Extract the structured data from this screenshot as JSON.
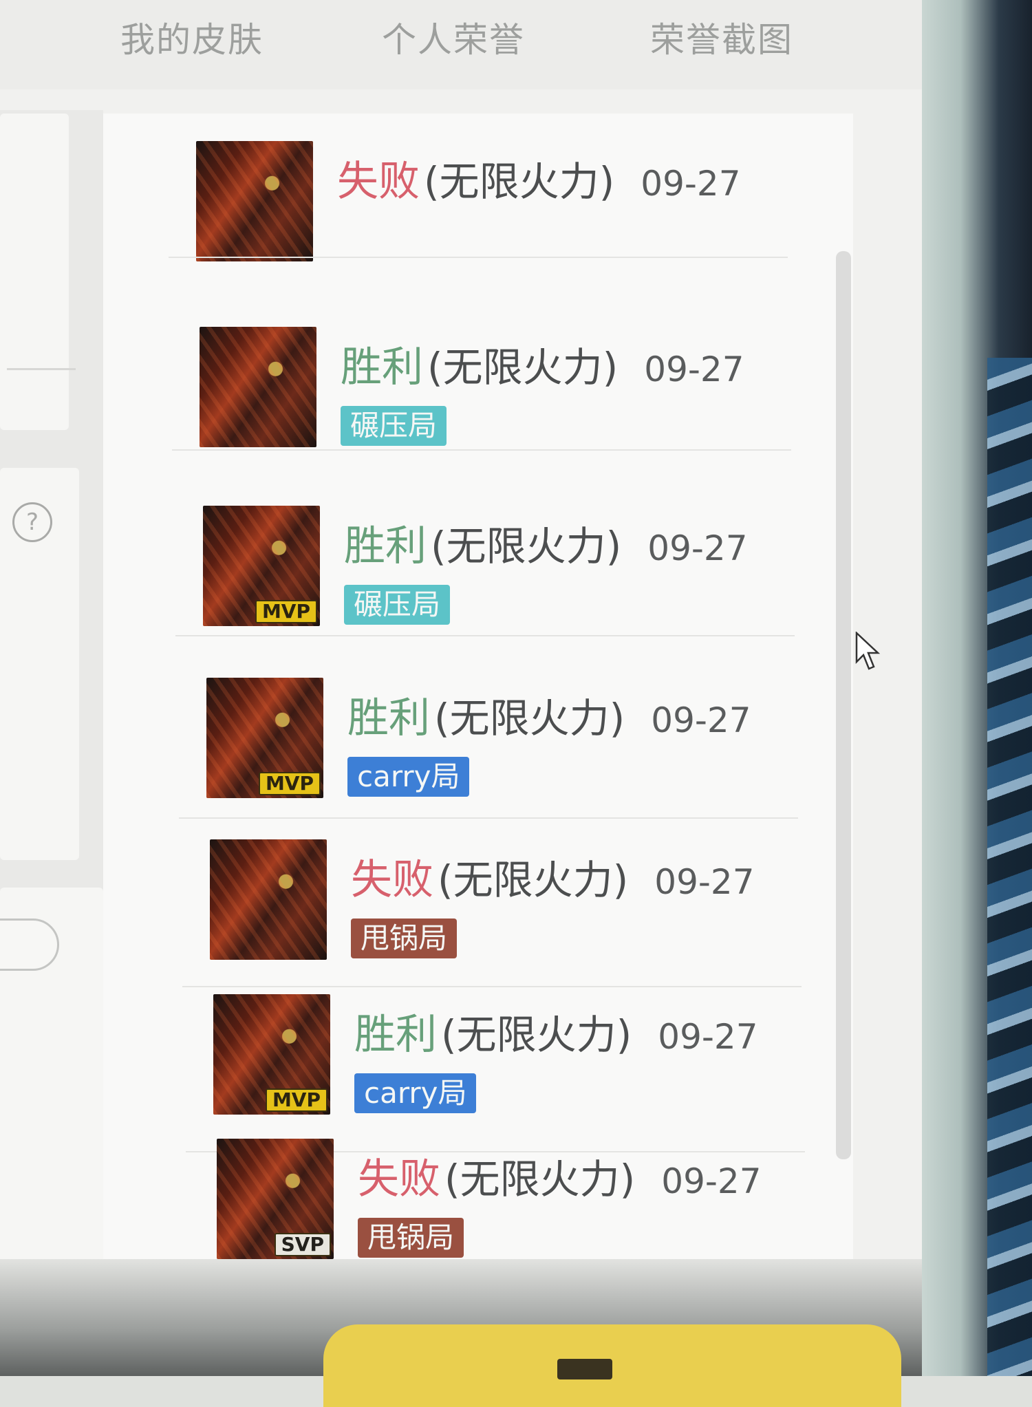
{
  "tabs": {
    "skins": "我的皮肤",
    "honor": "个人荣誉",
    "screenshots": "荣誉截图"
  },
  "sidebar": {
    "help_glyph": "?"
  },
  "matches": [
    {
      "result": "失败",
      "result_type": "lose",
      "mode": "(无限火力)",
      "date": "09-27",
      "badge": "",
      "tag": "",
      "tag_color": ""
    },
    {
      "result": "胜利",
      "result_type": "win",
      "mode": "(无限火力)",
      "date": "09-27",
      "badge": "",
      "tag": "碾压局",
      "tag_color": "#5cc3c8"
    },
    {
      "result": "胜利",
      "result_type": "win",
      "mode": "(无限火力)",
      "date": "09-27",
      "badge": "MVP",
      "tag": "碾压局",
      "tag_color": "#5cc3c8"
    },
    {
      "result": "胜利",
      "result_type": "win",
      "mode": "(无限火力)",
      "date": "09-27",
      "badge": "MVP",
      "tag": "carry局",
      "tag_color": "#3d7fd6"
    },
    {
      "result": "失败",
      "result_type": "lose",
      "mode": "(无限火力)",
      "date": "09-27",
      "badge": "",
      "tag": "甩锅局",
      "tag_color": "#9a5040"
    },
    {
      "result": "胜利",
      "result_type": "win",
      "mode": "(无限火力)",
      "date": "09-27",
      "badge": "MVP",
      "tag": "carry局",
      "tag_color": "#3d7fd6"
    },
    {
      "result": "失败",
      "result_type": "lose",
      "mode": "(无限火力)",
      "date": "09-27",
      "badge": "SVP",
      "tag": "甩锅局",
      "tag_color": "#9a5040"
    }
  ],
  "colors": {
    "win": "#67a07a",
    "lose": "#d7606c",
    "mvp_badge": "#e6c218"
  },
  "icons": {
    "help": "help-icon",
    "cursor": "mouse-cursor-icon"
  }
}
